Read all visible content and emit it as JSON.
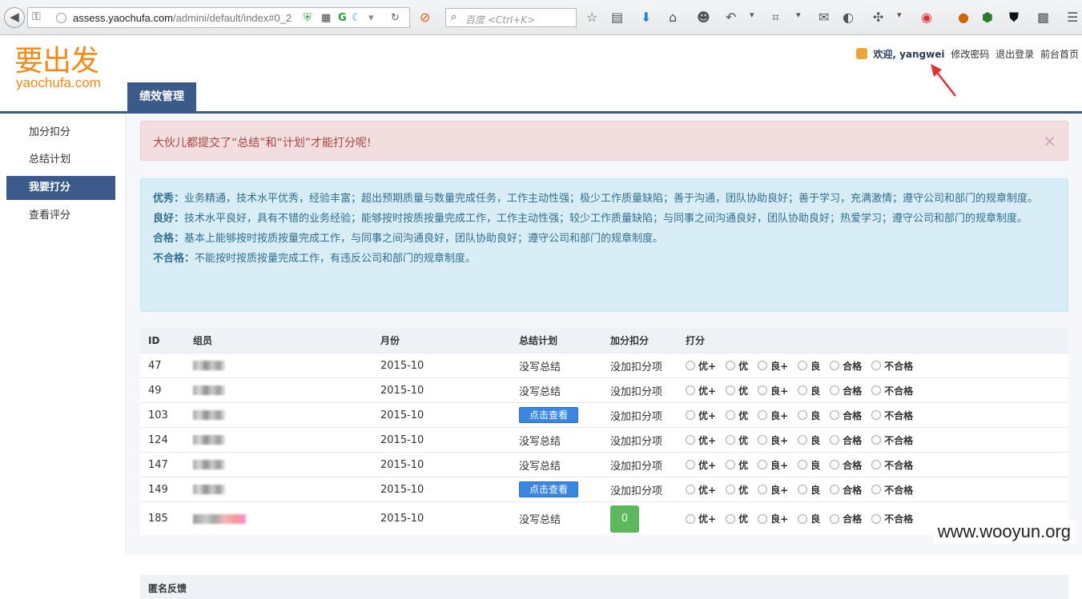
{
  "browser": {
    "url_host": "assess.yaochufa.com",
    "url_path": "/admini/default/index#0_2",
    "search_placeholder": "百度 <Ctrl+K>"
  },
  "header": {
    "logo_cn": "要出发",
    "logo_en": "yaochufa.com",
    "welcome": "欢迎, yangwei",
    "links": [
      "修改密码",
      "退出登录",
      "前台首页"
    ],
    "nav_tab": "绩效管理"
  },
  "sidebar": {
    "items": [
      {
        "label": "加分扣分",
        "active": false
      },
      {
        "label": "总结计划",
        "active": false
      },
      {
        "label": "我要打分",
        "active": true
      },
      {
        "label": "查看评分",
        "active": false
      }
    ]
  },
  "alert": {
    "text": "大伙儿都提交了“总结”和“计划”才能打分呢!",
    "close": "×"
  },
  "criteria": [
    {
      "level": "优秀：",
      "desc": "业务精通，技术水平优秀，经验丰富；超出预期质量与数量完成任务，工作主动性强；极少工作质量缺陷；善于沟通，团队协助良好；善于学习，充满激情；遵守公司和部门的规章制度。"
    },
    {
      "level": "良好：",
      "desc": "技术水平良好，具有不错的业务经验；能够按时按质按量完成工作，工作主动性强；较少工作质量缺陷；与同事之间沟通良好，团队协助良好；热爱学习；遵守公司和部门的规章制度。"
    },
    {
      "level": "合格：",
      "desc": "基本上能够按时按质按量完成工作，与同事之间沟通良好，团队协助良好；遵守公司和部门的规章制度。"
    },
    {
      "level": "不合格：",
      "desc": "不能按时按质按量完成工作，有违反公司和部门的规章制度。"
    }
  ],
  "table": {
    "headers": [
      "ID",
      "组员",
      "月份",
      "总结计划",
      "加分扣分",
      "打分"
    ],
    "score_options": [
      "优+",
      "优",
      "良+",
      "良",
      "合格",
      "不合格"
    ],
    "rows": [
      {
        "id": "47",
        "month": "2015-10",
        "plan": "没写总结",
        "plan_button": false,
        "bonus": "没加扣分项",
        "bonus_badge": null
      },
      {
        "id": "49",
        "month": "2015-10",
        "plan": "没写总结",
        "plan_button": false,
        "bonus": "没加扣分项",
        "bonus_badge": null
      },
      {
        "id": "103",
        "month": "2015-10",
        "plan": "点击查看",
        "plan_button": true,
        "bonus": "没加扣分项",
        "bonus_badge": null
      },
      {
        "id": "124",
        "month": "2015-10",
        "plan": "没写总结",
        "plan_button": false,
        "bonus": "没加扣分项",
        "bonus_badge": null
      },
      {
        "id": "147",
        "month": "2015-10",
        "plan": "没写总结",
        "plan_button": false,
        "bonus": "没加扣分项",
        "bonus_badge": null
      },
      {
        "id": "149",
        "month": "2015-10",
        "plan": "点击查看",
        "plan_button": true,
        "bonus": "没加扣分项",
        "bonus_badge": null
      },
      {
        "id": "185",
        "month": "2015-10",
        "plan": "没写总结",
        "plan_button": false,
        "bonus": "",
        "bonus_badge": "0"
      }
    ]
  },
  "footer_section": "匿名反馈",
  "watermark": "www.wooyun.org",
  "colors": {
    "primary": "#3b5a8a",
    "logo": "#f28a1a",
    "danger_bg": "#f2dede",
    "info_bg": "#d9edf7",
    "success": "#5cb85c",
    "button": "#3a86e0"
  }
}
